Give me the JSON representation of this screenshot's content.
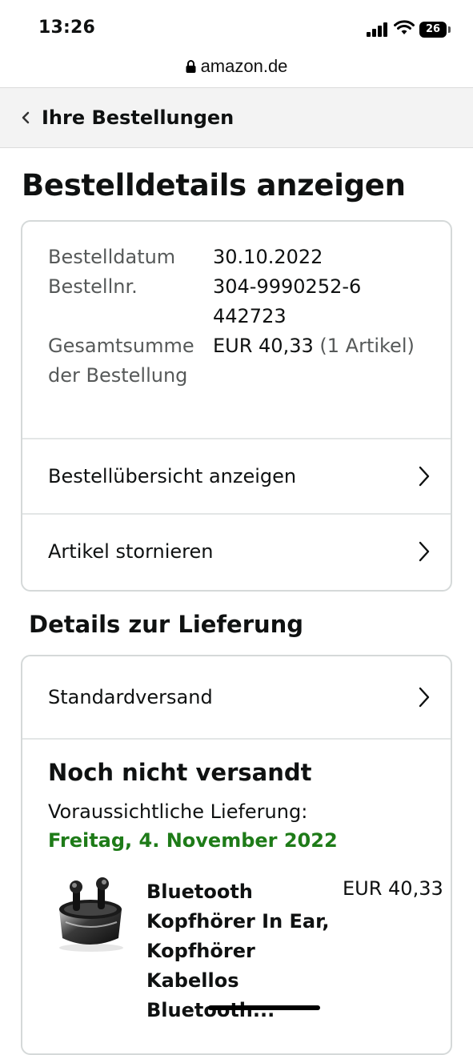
{
  "status_bar": {
    "time": "13:26",
    "battery": "26",
    "icons": [
      "signal-icon",
      "wifi-icon",
      "battery-icon"
    ]
  },
  "browser": {
    "url": "amazon.de",
    "lock_icon": "lock-icon"
  },
  "nav": {
    "back_label": "Ihre Bestellungen",
    "back_icon": "chevron-left-icon"
  },
  "page": {
    "title": "Bestelldetails anzeigen"
  },
  "order": {
    "date_label": "Bestelldatum",
    "date_value": "30.10.2022",
    "number_label": "Bestellnr.",
    "number_value": "304-9990252-6442723",
    "total_label": "Gesamtsumme der Bestellung",
    "total_value": "EUR 40,33",
    "total_items": "(1 Artikel)",
    "links": [
      {
        "label": "Bestellübersicht anzeigen"
      },
      {
        "label": "Artikel stornieren"
      }
    ]
  },
  "delivery": {
    "section_title": "Details zur Lieferung",
    "shipping_method": "Standardversand",
    "status": "Noch nicht versandt",
    "expected_label": "Voraussichtliche Lieferung:",
    "expected_date": "Freitag, 4. November 2022",
    "accent_color": "#1e7b18",
    "item": {
      "title": "Bluetooth Kopfhörer In Ear, Kopfhörer Kabellos Bluetooth...",
      "price": "EUR 40,33"
    }
  }
}
